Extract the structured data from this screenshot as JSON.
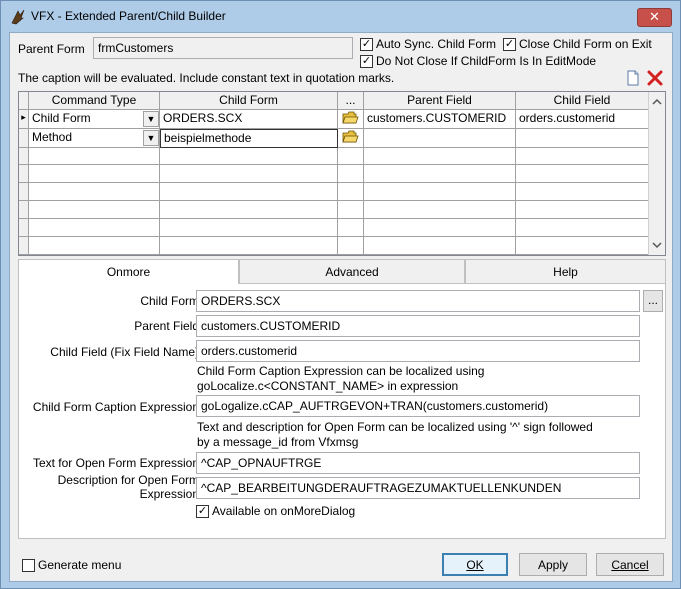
{
  "window": {
    "title": "VFX - Extended Parent/Child Builder",
    "close_glyph": "✕",
    "icon": "vfx-app-icon"
  },
  "top": {
    "parent_form_label": "Parent Form",
    "parent_form_value": "frmCustomers",
    "auto_sync_label": "Auto Sync. Child Form",
    "auto_sync_checked": true,
    "close_child_label": "Close Child Form on Exit",
    "close_child_checked": true,
    "do_not_close_label": "Do Not Close If ChildForm Is In EditMode",
    "do_not_close_checked": true,
    "caption_note": "The caption will be evaluated. Include constant text in quotation marks."
  },
  "grid": {
    "columns": [
      "Command Type",
      "Child Form",
      "...",
      "Parent Field",
      "Child Field"
    ],
    "rows": [
      {
        "command_type": "Child Form",
        "child_form": "ORDERS.SCX",
        "parent_field": "customers.CUSTOMERID",
        "child_field": "orders.customerid",
        "current": true
      },
      {
        "command_type": "Method",
        "child_form": "beispielmethode",
        "parent_field": "",
        "child_field": "",
        "current": false
      }
    ],
    "current_row_marker": "▸"
  },
  "tabs": [
    {
      "label": "Onmore",
      "active": true
    },
    {
      "label": "Advanced",
      "active": false
    },
    {
      "label": "Help",
      "active": false
    }
  ],
  "onmore": {
    "child_form_label": "Child Form",
    "child_form_value": "ORDERS.SCX",
    "browse_label": "...",
    "parent_field_label": "Parent Field",
    "parent_field_value": "customers.CUSTOMERID",
    "child_field_label": "Child Field (Fix Field Name)",
    "child_field_value": "orders.customerid",
    "caption_note_1": "Child Form Caption Expression can be localized using",
    "caption_note_2": "goLocalize.c<CONSTANT_NAME> in expression",
    "caption_expr_label": "Child Form Caption Expression",
    "caption_expr_value": "goLogalize.cCAP_AUFTRGEVON+TRAN(customers.customerid)",
    "text_note_1": "Text and description for Open Form can be localized using '^' sign followed",
    "text_note_2": "by a message_id from Vfxmsg",
    "open_text_label": "Text for Open Form Expression",
    "open_text_value": "^CAP_OPNAUFTRGE",
    "open_desc_label_1": "Description for Open Form",
    "open_desc_label_2": "Expression",
    "open_desc_value": "^CAP_BEARBEITUNGDERAUFTRAGEZUMAKTUELLENKUNDEN",
    "available_label": "Available on onMoreDialog",
    "available_checked": true
  },
  "footer": {
    "generate_menu_label": "Generate menu",
    "generate_menu_checked": false,
    "ok_label": "OK",
    "apply_label": "Apply",
    "cancel_label": "Cancel"
  },
  "icons": {
    "new": "new-document-icon",
    "delete": "delete-x-icon",
    "folder": "open-folder-icon",
    "check_mark": "✓"
  },
  "colors": {
    "title_bar": "#aecbe8",
    "close_button": "#c7504a",
    "delete_icon": "#d42020",
    "folder_icon": "#e8c040"
  }
}
